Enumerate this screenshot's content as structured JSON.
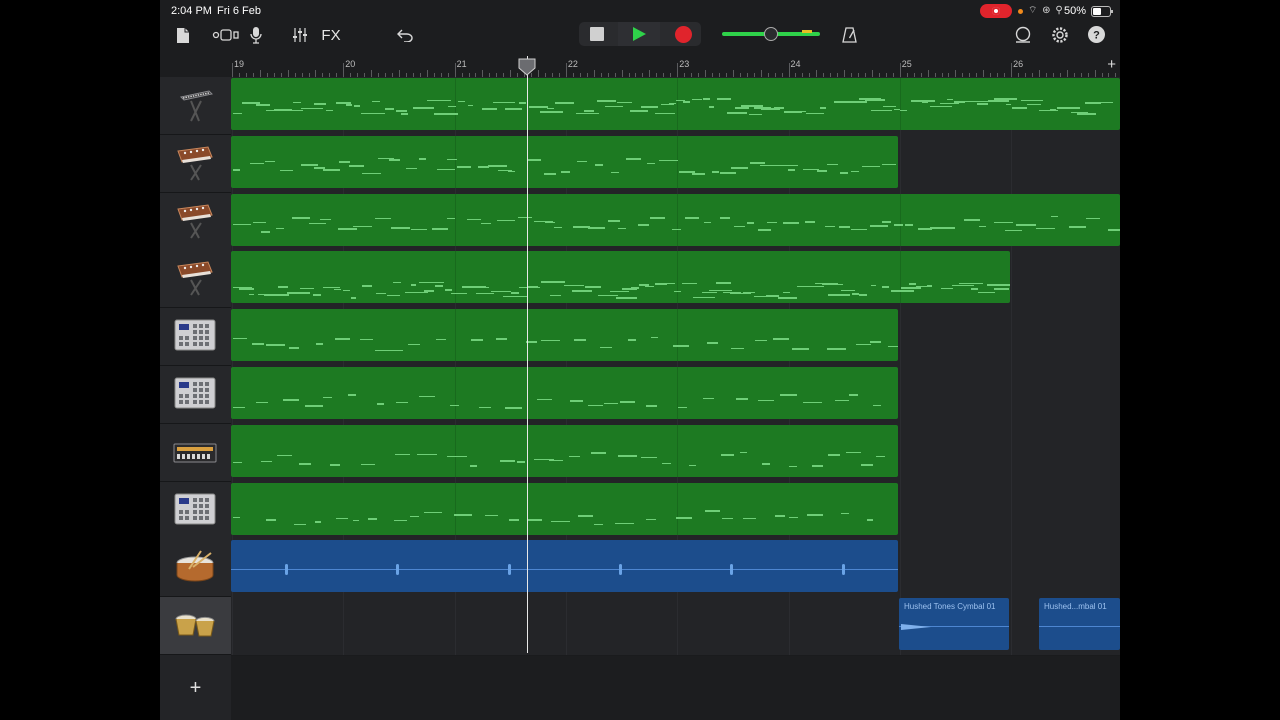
{
  "status": {
    "time": "2:04 PM",
    "date": "Fri 6 Feb",
    "battery": "50%"
  },
  "toolbar": {
    "fx_label": "FX"
  },
  "ruler": {
    "bars": [
      "19",
      "20",
      "21",
      "22",
      "23",
      "24",
      "25",
      "26"
    ]
  },
  "tracks": [
    {
      "instrument": "keyboard-stand"
    },
    {
      "instrument": "analog-synth"
    },
    {
      "instrument": "analog-synth"
    },
    {
      "instrument": "analog-synth"
    },
    {
      "instrument": "drum-machine"
    },
    {
      "instrument": "drum-machine"
    },
    {
      "instrument": "beat-box"
    },
    {
      "instrument": "drum-machine"
    },
    {
      "instrument": "snare-drum"
    },
    {
      "instrument": "bongos"
    }
  ],
  "clips": {
    "clip1_title": "Hushed Tones Cymbal 01",
    "clip2_title": "Hushed...mbal 01"
  },
  "colors": {
    "midi_region": "#1d7a22",
    "audio_region": "#1c4d8c",
    "play": "#2fd24a",
    "record": "#e0242c"
  }
}
